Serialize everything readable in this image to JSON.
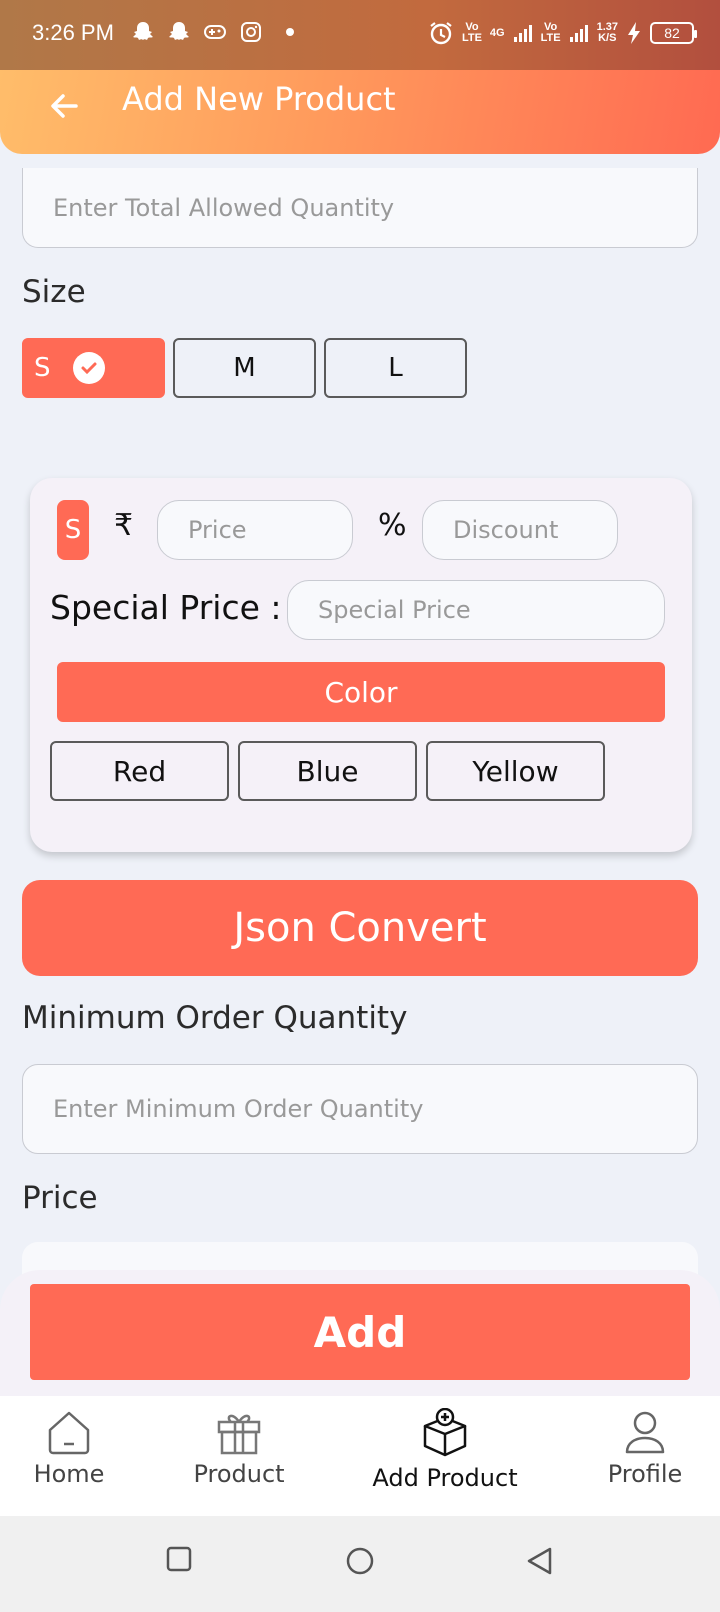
{
  "status_bar": {
    "time": "3:26 PM",
    "net1": "Vo\nLTE",
    "net_4g": "4G",
    "net2": "Vo\nLTE",
    "speed": "1.37\nK/S",
    "battery": "82"
  },
  "header": {
    "title": "Add New Product"
  },
  "form": {
    "total_qty_placeholder": "Enter Total Allowed Quantity",
    "size_label": "Size",
    "sizes": [
      "S",
      "M",
      "L"
    ],
    "selected_size": "S",
    "variant_card": {
      "size_chip": "S",
      "currency_symbol": "₹",
      "price_placeholder": "Price",
      "percent_symbol": "%",
      "discount_placeholder": "Discount",
      "special_price_label": "Special Price :",
      "special_price_placeholder": "Special Price",
      "color_header": "Color",
      "colors": [
        "Red",
        "Blue",
        "Yellow"
      ]
    },
    "json_convert_label": "Json Convert",
    "min_order_label": "Minimum Order Quantity",
    "min_order_placeholder": "Enter Minimum Order Quantity",
    "price_label": "Price",
    "add_label": "Add"
  },
  "bottom_nav": {
    "items": [
      {
        "label": "Home",
        "icon": "home-icon"
      },
      {
        "label": "Product",
        "icon": "gift-icon"
      },
      {
        "label": "Add Product",
        "icon": "add-box-icon"
      },
      {
        "label": "Profile",
        "icon": "person-icon"
      }
    ],
    "active": "Add Product"
  },
  "colors": {
    "accent": "#ff6a55",
    "header_gradient_start": "#ffbd6a",
    "header_gradient_end": "#ff6a52",
    "background": "#eef1f8"
  }
}
